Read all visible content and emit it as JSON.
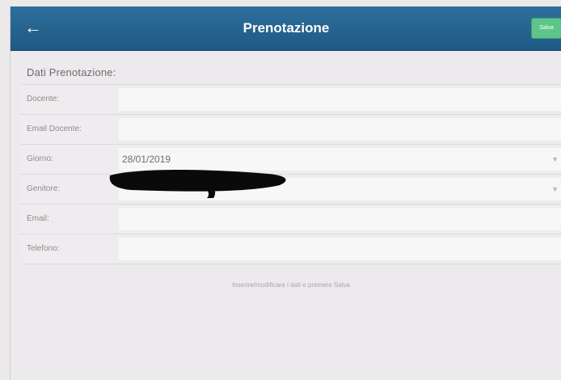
{
  "header": {
    "title": "Prenotazione",
    "back_icon": "arrow-left-icon",
    "save_label": "Salva"
  },
  "section": {
    "title": "Dati Prenotazione:"
  },
  "form": {
    "docente": {
      "label": "Docente:",
      "value": ""
    },
    "email_docente": {
      "label": "Email Docente:",
      "value": ""
    },
    "giorno": {
      "label": "Giorno:",
      "value": "28/01/2019"
    },
    "genitore": {
      "label": "Genitore:",
      "value": ""
    },
    "email": {
      "label": "Email:",
      "value": ""
    },
    "telefono": {
      "label": "Telefono:",
      "value": ""
    }
  },
  "hint": "Inserire/modificare i dati e premere Salva",
  "colors": {
    "navbar": "#1d5984",
    "save_button": "#5ec58a",
    "background": "#eceaec"
  }
}
